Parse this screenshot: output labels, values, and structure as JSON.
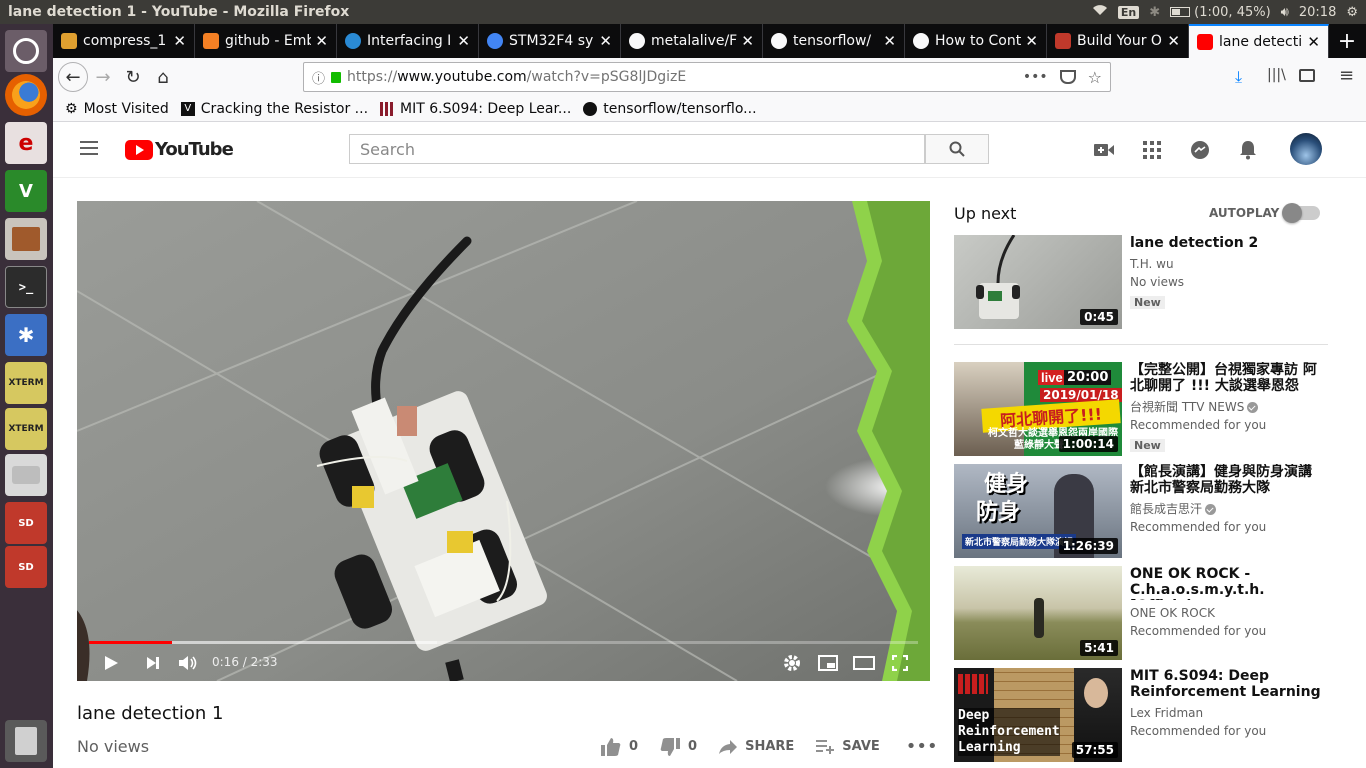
{
  "system": {
    "window_title": "lane detection 1 - YouTube - Mozilla Firefox",
    "language": "En",
    "battery": "(1:00, 45%)",
    "clock": "20:18"
  },
  "launcher": {
    "items": [
      "ubuntu-logo-icon",
      "firefox-icon",
      "emacs-icon",
      "vim-icon",
      "file-cabinet-icon",
      "terminal-icon",
      "bluetooth-icon",
      "xterm-icon",
      "xterm-icon",
      "drive-icon",
      "sd-card-icon",
      "sd-card-icon",
      "trash-icon"
    ],
    "xterm_label": "XTERM",
    "sd_label": "SD"
  },
  "browser": {
    "tabs": [
      {
        "label": "compress_1",
        "favicon": "#e0a030"
      },
      {
        "label": "github - Emb",
        "favicon": "#f48024"
      },
      {
        "label": "Interfacing I",
        "favicon": "#2a8ad4"
      },
      {
        "label": "STM32F4 sy",
        "favicon": "#4285f4"
      },
      {
        "label": "metalalive/F",
        "favicon": "#f9f9fa"
      },
      {
        "label": "tensorflow/",
        "favicon": "#f9f9fa"
      },
      {
        "label": "How to Cont",
        "favicon": "#f9f9fa"
      },
      {
        "label": "Build Your O",
        "favicon": "#c0392b"
      },
      {
        "label": "lane detecti",
        "favicon": "#ff0000"
      }
    ],
    "url_prefix": "https://",
    "url_host": "www.youtube.com",
    "url_path": "/watch?v=pSG8lJDgizE",
    "bookmarks": [
      {
        "label": "Most Visited",
        "icon": "gear-icon"
      },
      {
        "label": "Cracking the Resistor ...",
        "icon": "v-logo-icon"
      },
      {
        "label": "MIT 6.S094: Deep Lear...",
        "icon": "mit-logo-icon"
      },
      {
        "label": "tensorflow/tensorflo...",
        "icon": "github-icon"
      }
    ]
  },
  "youtube": {
    "logo_text": "YouTube",
    "search_placeholder": "Search",
    "video": {
      "title": "lane detection 1",
      "views": "No views",
      "time": "0:16 / 2:33",
      "progress_played": 0.1,
      "progress_buffered": 0.42,
      "likes": "0",
      "dislikes": "0",
      "share_label": "SHARE",
      "save_label": "SAVE"
    },
    "up_next_label": "Up next",
    "autoplay_label": "AUTOPLAY",
    "autoplay_on": false,
    "recommendations": [
      {
        "title": "lane detection 2",
        "channel": "T.H. wu",
        "line3": "No views",
        "badge": "New",
        "duration": "0:45",
        "verified": false
      },
      {
        "title": "【完整公開】台視獨家專訪 阿北聊開了 !!! 大談選舉恩怨",
        "channel": "台視新聞 TTV NEWS",
        "line3": "Recommended for you",
        "badge": "New",
        "duration": "1:00:14",
        "verified": true,
        "thumb_live": "live",
        "thumb_time": "20:00",
        "thumb_date": "2019/01/18",
        "thumb_headline": "阿北聊開了!!!",
        "thumb_sub": "柯文哲大談選舉恩怨兩岸國際",
        "thumb_sub2": "藍綠靜大聲"
      },
      {
        "title": "【館長演講】健身與防身演講 新北市警察局勤務大隊",
        "channel": "館長成吉思汗",
        "line3": "Recommended for you",
        "badge": "",
        "duration": "1:26:39",
        "verified": true,
        "thumb_big1": "健身",
        "thumb_big2": "防身",
        "thumb_caption": "新北市警察局勤務大隊演講"
      },
      {
        "title": "ONE OK ROCK - C.h.a.o.s.m.y.t.h. [Official",
        "channel": "ONE OK ROCK",
        "line3": "Recommended for you",
        "badge": "",
        "duration": "5:41",
        "verified": false
      },
      {
        "title": "MIT 6.S094: Deep Reinforcement Learning",
        "channel": "Lex Fridman",
        "line3": "Recommended for you",
        "badge": "",
        "duration": "57:55",
        "verified": false,
        "thumb_line1": "Deep",
        "thumb_line2": "Reinforcement",
        "thumb_line3": "Learning"
      }
    ]
  }
}
